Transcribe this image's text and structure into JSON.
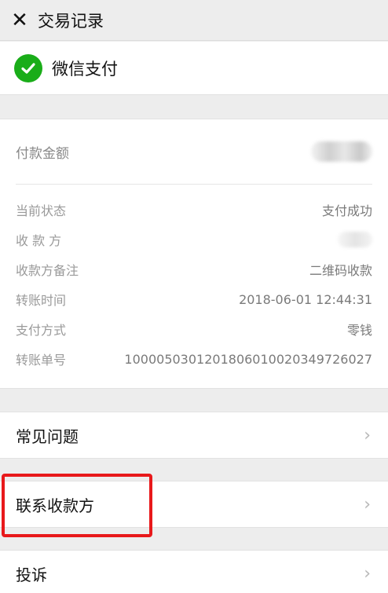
{
  "header": {
    "close_icon": "close-icon",
    "close_glyph": "✕",
    "title": "交易记录"
  },
  "merchant": {
    "icon": "wechat-pay-icon",
    "name": "微信支付"
  },
  "amount": {
    "label": "付款金额",
    "value_obscured": true
  },
  "details": {
    "status_label": "当前状态",
    "status_value": "支付成功",
    "payee_label": "收 款 方",
    "payee_value_obscured": true,
    "remark_label": "收款方备注",
    "remark_value": "二维码收款",
    "time_label": "转账时间",
    "time_value": "2018-06-01 12:44:31",
    "method_label": "支付方式",
    "method_value": "零钱",
    "order_label": "转账单号",
    "order_value": "1000050301201806010020349726027"
  },
  "menu": {
    "faq": "常见问题",
    "contact_payee": "联系收款方",
    "complaint": "投诉",
    "chevron": "›"
  },
  "colors": {
    "highlight": "#e8191b",
    "wechat_green": "#1aad19"
  }
}
